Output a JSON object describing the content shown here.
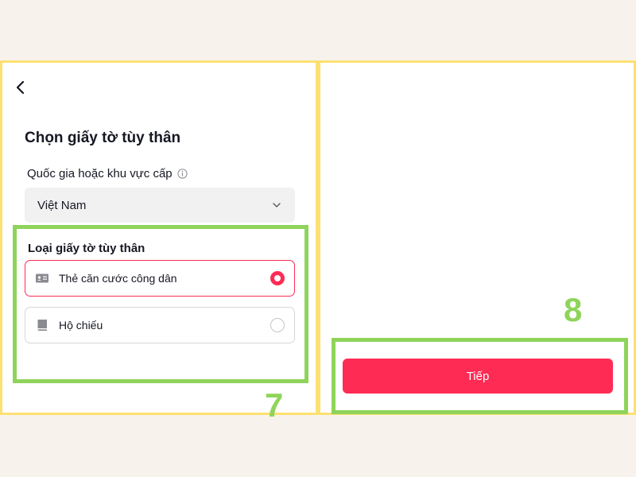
{
  "left_screen": {
    "title": "Chọn giấy tờ tùy thân",
    "country_label": "Quốc gia hoặc khu vực cấp",
    "country_value": "Việt Nam",
    "id_type_label": "Loại giấy tờ tùy thân",
    "options": [
      {
        "label": "Thẻ căn cước công dân",
        "selected": true,
        "icon": "id-card-icon"
      },
      {
        "label": "Hộ chiếu",
        "selected": false,
        "icon": "passport-book-icon"
      }
    ],
    "step_number": "7"
  },
  "right_screen": {
    "next_label": "Tiếp",
    "step_number": "8"
  },
  "colors": {
    "accent": "#fe2c55",
    "highlight": "#8fd45a",
    "panel_border": "#fde072",
    "background": "#f7f3ec"
  }
}
